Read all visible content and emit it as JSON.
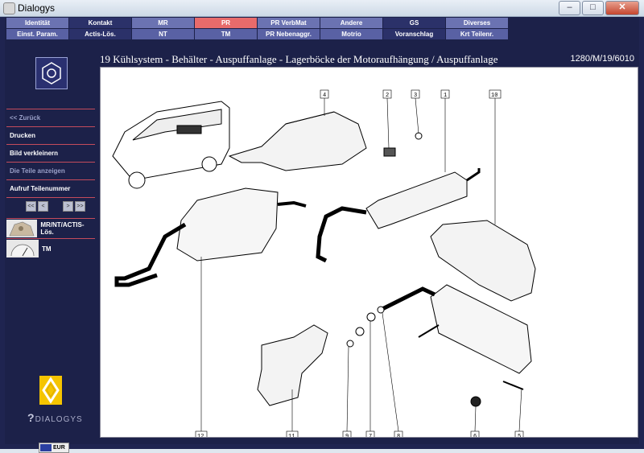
{
  "window": {
    "title": "Dialogys"
  },
  "tabs": {
    "row1": [
      "Identität",
      "Kontakt",
      "MR",
      "PR",
      "PR VerbMat",
      "Andere",
      "GS",
      "Diverses"
    ],
    "row2": [
      "Einst. Param.",
      "Actis-Lös.",
      "NT",
      "TM",
      "PR Nebenaggr.",
      "Motrio",
      "Voranschlag",
      "Krt Teilenr."
    ]
  },
  "header": {
    "title": "19 Kühlsystem - Behälter - Auspuffanlage - Lagerböcke der Motoraufhängung / Auspuffanlage",
    "code": "1280/M/19/6010"
  },
  "sidebar": {
    "back": "<< Zurück",
    "print": "Drucken",
    "shrink": "Bild verkleinern",
    "show_parts": "Die Teile anzeigen",
    "call_part": "Aufruf Teilenummer",
    "pager": [
      "<<",
      "<",
      ">",
      ">>"
    ],
    "link1": "MR/NT/ACTIS-Lös.",
    "link2": "TM",
    "brand": "DIALOGYS",
    "currency": "EUR"
  },
  "diagram": {
    "callouts": [
      "4",
      "2",
      "3",
      "1",
      "10",
      "12",
      "11",
      "9",
      "7",
      "8",
      "6",
      "5"
    ]
  },
  "colors": {
    "accent": "#e86b6b",
    "frame": "#1c2149",
    "tab": "#6b73b2"
  }
}
